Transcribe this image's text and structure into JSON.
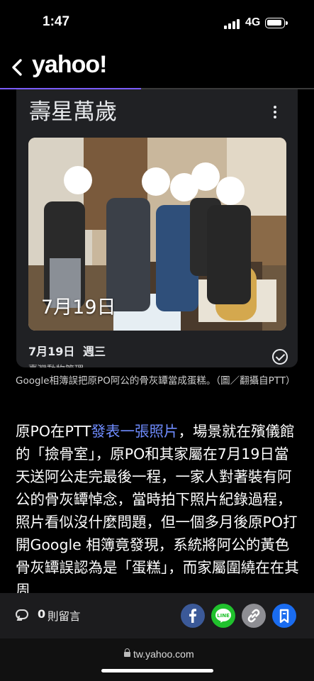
{
  "status_bar": {
    "time": "1:47",
    "network": "4G"
  },
  "nav": {
    "logo": "yahoo!",
    "reading_progress": 0.45
  },
  "photo_card": {
    "album_title": "壽星萬歲",
    "photo_date_overlay": "7月19日",
    "date": "7月19日",
    "weekday": "週三",
    "cut_off_text": "臺灣動物管理"
  },
  "caption": "Google相簿誤把原PO阿公的骨灰罈當成蛋糕。（圖／翻攝自PTT）",
  "body": {
    "part1": "原PO在PTT",
    "link": "發表一張照片",
    "part2": "，場景就在殯儀館的「撿骨室」，原PO和其家屬在7月19日當天送阿公走完最後一程，一家人對著裝有阿公的骨灰罈悼念，當時拍下照片紀錄過程，照片看似沒什麼問題，但一個多月後原PO打開Google 相簿竟發現，系統將阿公的黃色骨灰罈誤認為是「蛋糕」，而家屬圍繞在在其周"
  },
  "action_bar": {
    "comment_count": "0",
    "comment_label": "則留言"
  },
  "url_bar": {
    "url": "tw.yahoo.com"
  },
  "colors": {
    "progress": "#7b5cff",
    "link": "#6f8cff",
    "facebook": "#3b5998",
    "line": "#20c12d",
    "save": "#1a6cf0"
  }
}
